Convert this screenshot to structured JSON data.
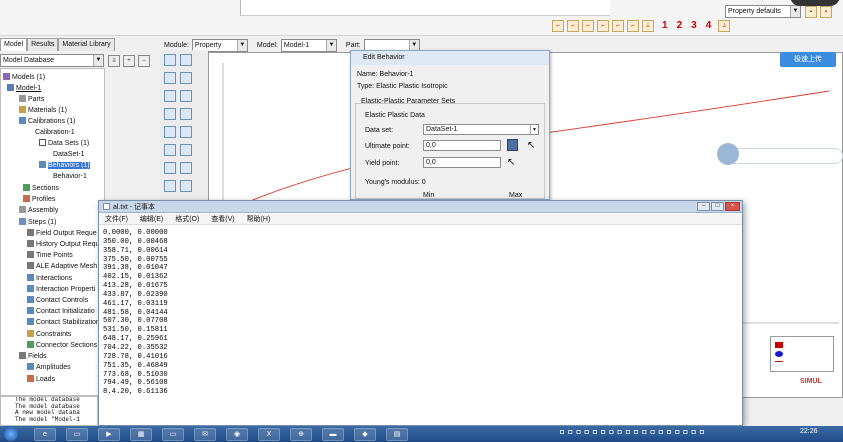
{
  "top": {
    "module_label": "Module:",
    "module_value": "Property",
    "model_label": "Model:",
    "model_value": "Model-1",
    "part_label": "Part:",
    "part_value": "",
    "property_defaults": "Property defaults",
    "view_numbers": [
      "1",
      "2",
      "3",
      "4"
    ]
  },
  "tabs": [
    "Model",
    "Results",
    "Material Library"
  ],
  "tree": {
    "database": "Model Database",
    "items": [
      "Models (1)",
      "Model-1",
      "Parts",
      "Materials (1)",
      "Calibrations (1)",
      "Calibration-1",
      "Data Sets (1)",
      "DataSet-1",
      "Behaviors (1)",
      "Behavior-1",
      "Sections",
      "Profiles",
      "Assembly",
      "Steps (1)",
      "Field Output Reque",
      "History Output Requ",
      "Time Points",
      "ALE Adaptive Mesh",
      "Interactions",
      "Interaction Properti",
      "Contact Controls",
      "Contact Initializatio",
      "Contact Stabilization",
      "Constraints",
      "Connector Sections",
      "Fields",
      "Amplitudes",
      "Loads"
    ]
  },
  "dialog": {
    "title": "Edit Behavior",
    "name_line": "Name: Behavior-1",
    "type_line": "Type: Elastic Plastic Isotropic",
    "section_label": "Elastic-Plastic Parameter Sets",
    "subsection_label": "Elastic Plastic Data",
    "dataset_label": "Data set:",
    "dataset_value": "DataSet-1",
    "ultimate_label": "Ultimate point:",
    "ultimate_value": "0,0",
    "yield_label": "Yield point:",
    "yield_value": "0,0",
    "youngs_line": "Young's modulus:  0",
    "min_label": "Min",
    "max_label": "Max"
  },
  "notepad": {
    "title": "al.txt - 记事本",
    "menu": [
      "文件(F)",
      "编辑(E)",
      "格式(O)",
      "查看(V)",
      "帮助(H)"
    ],
    "lines": [
      "0.0000, 0.00000",
      "350.00, 0.00468",
      "358.71, 0.00614",
      "375.50, 0.00755",
      "391.38, 0.01047",
      "402.15, 0.01362",
      "413.28, 0.01675",
      "433.87, 0.02390",
      "461.17, 0.03119",
      "481.58, 0.04144",
      "507.30, 0.07708",
      "531.50, 0.15811",
      "648.17, 0.25961",
      "704.22, 0.35532",
      "728.78, 0.41016",
      "751.35, 0.46849",
      "773.68, 0.51030",
      "794.49, 0.56108",
      "8.4.20, 0.61136"
    ]
  },
  "console": {
    "lines": [
      "The model database",
      "The model database",
      "A new model databa",
      "The model \"Model-1"
    ]
  },
  "cloud": {
    "upload_label": "极速上传"
  },
  "taskbar": {
    "clock": "22:26"
  },
  "colors": {
    "curve": "#d63a2a",
    "selection": "#3875d7",
    "upload": "#3b8be0",
    "taskbar": "#2a5a98"
  }
}
